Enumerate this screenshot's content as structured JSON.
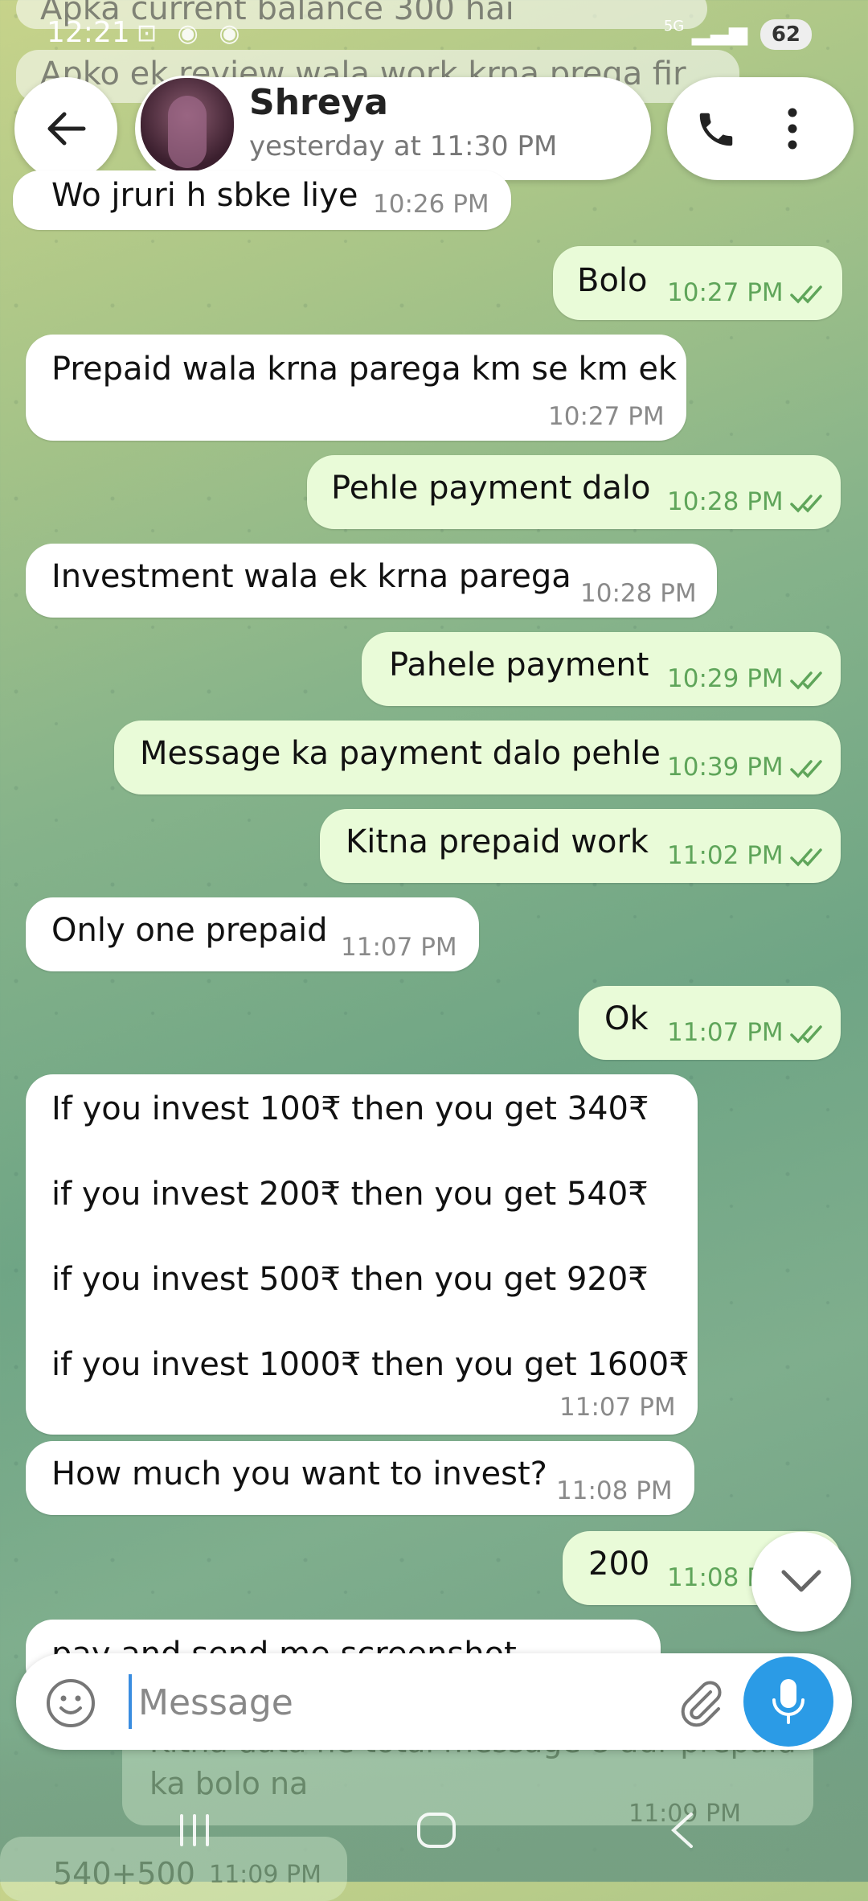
{
  "status_bar": {
    "time": "12:21",
    "network": "5G",
    "battery": "62"
  },
  "faded_top": {
    "line1": "Apka current balance 300 hai",
    "line2": "Apko ek review wala work krna prega fir"
  },
  "header": {
    "name": "Shreya",
    "status": "yesterday at 11:30 PM"
  },
  "messages": [
    {
      "dir": "in",
      "text": "Wo jruri h sbke liye",
      "time": "10:26 PM"
    },
    {
      "dir": "out",
      "text": "Bolo",
      "time": "10:27 PM"
    },
    {
      "dir": "in",
      "text": "Prepaid wala krna parega km se km ek",
      "time": "10:27 PM"
    },
    {
      "dir": "out",
      "text": "Pehle payment dalo",
      "time": "10:28 PM"
    },
    {
      "dir": "in",
      "text": "Investment wala ek krna parega",
      "time": "10:28 PM"
    },
    {
      "dir": "out",
      "text": "Pahele payment",
      "time": "10:29 PM"
    },
    {
      "dir": "out",
      "text": "Message ka payment dalo pehle",
      "time": "10:39 PM"
    },
    {
      "dir": "out",
      "text": "Kitna prepaid work",
      "time": "11:02 PM"
    },
    {
      "dir": "in",
      "text": "Only one prepaid",
      "time": "11:07 PM"
    },
    {
      "dir": "out",
      "text": "Ok",
      "time": "11:07 PM"
    },
    {
      "dir": "in",
      "lines": [
        "If you invest 100₹ then you get 340₹",
        "if you invest 200₹ then you get 540₹",
        "if you invest 500₹ then you get 920₹",
        "if you invest 1000₹ then you get 1600₹"
      ],
      "time": "11:07 PM"
    },
    {
      "dir": "in",
      "text": "How much you want to invest?",
      "time": "11:08 PM"
    },
    {
      "dir": "out",
      "text": "200",
      "time": "11:08 PM"
    },
    {
      "dir": "in",
      "text": "pay and send me screenshot",
      "time": ""
    }
  ],
  "composer": {
    "placeholder": "Message"
  },
  "faded_bottom": {
    "msg1_line1": "Kitna data he total message 8 aur prepaid",
    "msg1_line2": "ka bolo na",
    "msg1_time": "11:09 PM",
    "msg2_text": "540+500",
    "msg2_time": "11:09 PM"
  },
  "colors": {
    "accent": "#2b9be6",
    "outgoing": "#e9fbd8",
    "incoming": "#ffffff",
    "tick": "#5fa55a"
  }
}
